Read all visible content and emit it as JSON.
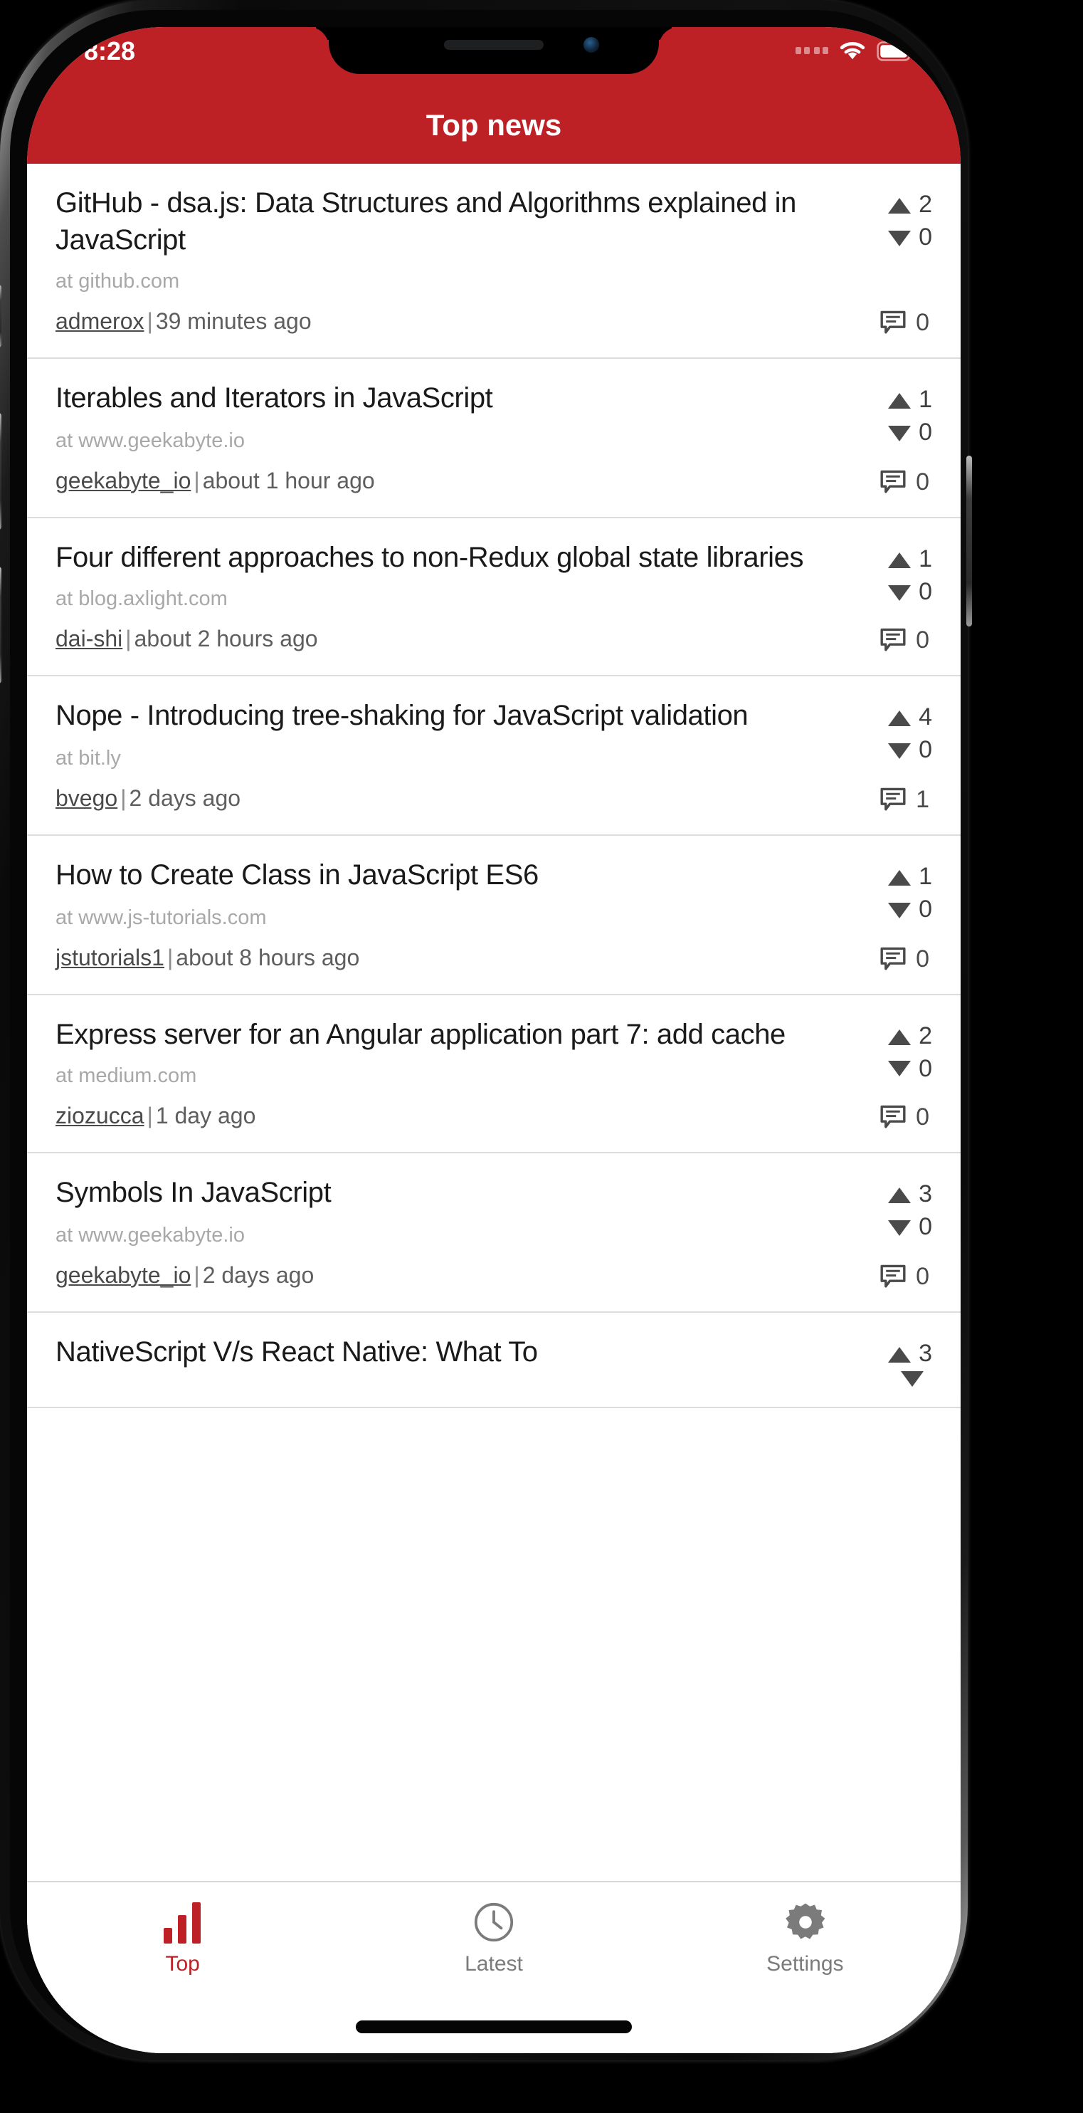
{
  "theme": {
    "brand_red": "#bd2025",
    "text_dark": "#1a1a1a",
    "text_muted": "#a8a8a8",
    "text_meta": "#5e5e5e",
    "tab_inactive": "#7b7b7b"
  },
  "status_bar": {
    "time": "8:28",
    "signal_icon": "signal-dots-icon",
    "wifi_icon": "wifi-icon",
    "battery_icon": "battery-full-icon"
  },
  "header": {
    "title": "Top news"
  },
  "news": {
    "items": [
      {
        "title": "GitHub - dsa.js: Data Structures and Algorithms explained in JavaScript",
        "domain": "at github.com",
        "author": "admerox",
        "time": "39 minutes ago",
        "upvotes": "2",
        "downvotes": "0",
        "comments": "0"
      },
      {
        "title": "Iterables and Iterators in JavaScript",
        "domain": "at www.geekabyte.io",
        "author": "geekabyte_io",
        "time": "about 1 hour ago",
        "upvotes": "1",
        "downvotes": "0",
        "comments": "0"
      },
      {
        "title": "Four different approaches to non-Redux global state libraries",
        "domain": "at blog.axlight.com",
        "author": "dai-shi",
        "time": "about 2 hours ago",
        "upvotes": "1",
        "downvotes": "0",
        "comments": "0"
      },
      {
        "title": "Nope - Introducing tree-shaking for JavaScript validation",
        "domain": "at bit.ly",
        "author": "bvego",
        "time": "2 days ago",
        "upvotes": "4",
        "downvotes": "0",
        "comments": "1"
      },
      {
        "title": "How to Create Class in JavaScript ES6",
        "domain": "at www.js-tutorials.com",
        "author": "jstutorials1",
        "time": "about 8 hours ago",
        "upvotes": "1",
        "downvotes": "0",
        "comments": "0"
      },
      {
        "title": "Express server for an Angular application part 7: add cache",
        "domain": "at medium.com",
        "author": "ziozucca",
        "time": "1 day ago",
        "upvotes": "2",
        "downvotes": "0",
        "comments": "0"
      },
      {
        "title": "Symbols In JavaScript",
        "domain": "at www.geekabyte.io",
        "author": "geekabyte_io",
        "time": "2 days ago",
        "upvotes": "3",
        "downvotes": "0",
        "comments": "0"
      },
      {
        "title": "NativeScript V/s React Native: What To",
        "domain": "",
        "author": "",
        "time": "",
        "upvotes": "3",
        "downvotes": "",
        "comments": ""
      }
    ],
    "meta_separator": "|"
  },
  "tab_bar": {
    "tabs": [
      {
        "label": "Top",
        "icon": "bar-chart-icon",
        "active": true
      },
      {
        "label": "Latest",
        "icon": "clock-icon",
        "active": false
      },
      {
        "label": "Settings",
        "icon": "gear-icon",
        "active": false
      }
    ]
  }
}
